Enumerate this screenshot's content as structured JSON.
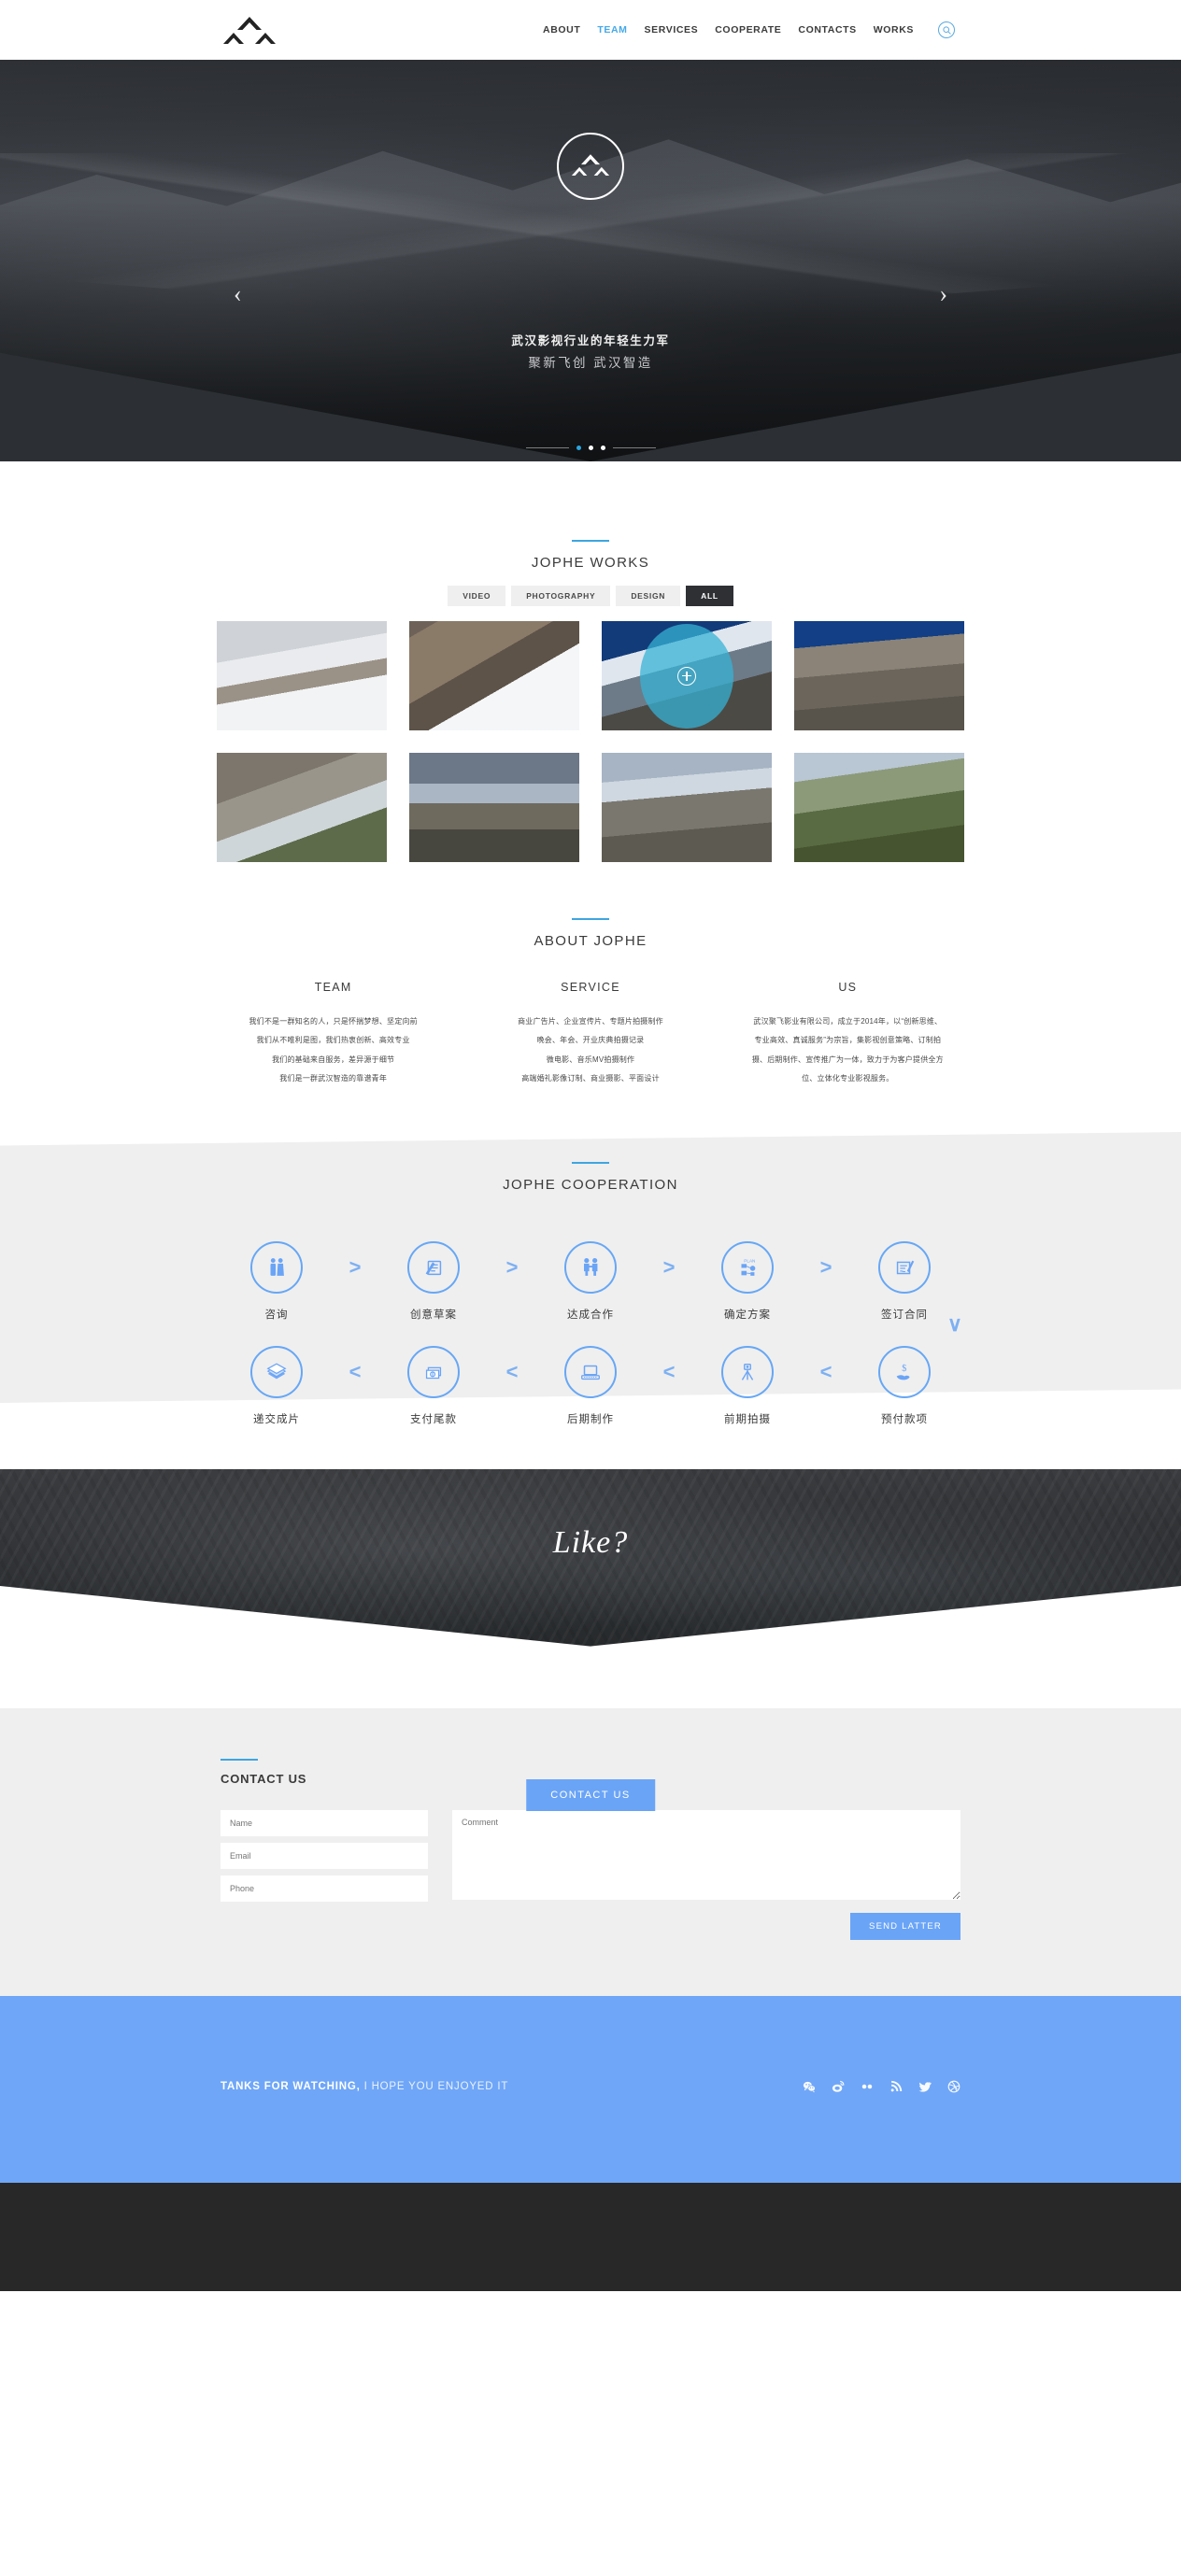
{
  "header": {
    "logo_name": "jophe-logo",
    "nav": [
      {
        "label": "ABOUT",
        "active": false
      },
      {
        "label": "TEAM",
        "active": true
      },
      {
        "label": "SERVICES",
        "active": false
      },
      {
        "label": "COOPERATE",
        "active": false
      },
      {
        "label": "CONTACTS",
        "active": false
      },
      {
        "label": "WORKS",
        "active": false
      }
    ],
    "search_icon": "search-icon"
  },
  "hero": {
    "title": "武汉影视行业的年轻生力军",
    "subtitle": "聚新飞创 武汉智造",
    "prev_arrow": "‹",
    "next_arrow": "›",
    "slides": 3,
    "active_slide": 1,
    "badge_icon": "mountain-logo-icon"
  },
  "works": {
    "title": "JOPHE WORKS",
    "filters": [
      {
        "label": "VIDEO",
        "active": false
      },
      {
        "label": "PHOTOGRAPHY",
        "active": false
      },
      {
        "label": "DESIGN",
        "active": false
      },
      {
        "label": "ALL",
        "active": true
      }
    ],
    "tiles": [
      {
        "name": "work-tile-1",
        "style": "im1",
        "hovered": false
      },
      {
        "name": "work-tile-2",
        "style": "im2",
        "hovered": false
      },
      {
        "name": "work-tile-3",
        "style": "im3",
        "hovered": true
      },
      {
        "name": "work-tile-4",
        "style": "im4",
        "hovered": false
      },
      {
        "name": "work-tile-5",
        "style": "im5",
        "hovered": false
      },
      {
        "name": "work-tile-6",
        "style": "im6",
        "hovered": false
      },
      {
        "name": "work-tile-7",
        "style": "im7",
        "hovered": false
      },
      {
        "name": "work-tile-8",
        "style": "im8",
        "hovered": false
      }
    ],
    "zoom_icon": "zoom-plus-icon"
  },
  "about": {
    "title": "ABOUT JOPHE",
    "columns": [
      {
        "heading": "TEAM",
        "lines": [
          "我们不是一群知名的人，只是怀揣梦想、坚定向前",
          "我们从不唯利是图，我们热衷创新、高效专业",
          "我们的基础来自服务，差异源于细节",
          "我们是一群武汉智造的靠谱青年"
        ]
      },
      {
        "heading": "SERVICE",
        "lines": [
          "商业广告片、企业宣传片、专题片拍摄制作",
          "晚会、年会、开业庆典拍摄记录",
          "微电影、音乐MV拍摄制作",
          "高端婚礼影像订制、商业摄影、平面设计"
        ]
      },
      {
        "heading": "US",
        "lines": [
          "武汉聚飞影业有限公司，成立于2014年，以“创新思维、",
          "专业高效、真诚服务”为宗旨，集影视创意策略、订制拍",
          "摄、后期制作、宣传推广为一体，致力于为客户提供全方",
          "位、立体化专业影视服务。"
        ]
      }
    ]
  },
  "cooperation": {
    "title": "JOPHE COOPERATION",
    "row1": [
      {
        "label": "咨询",
        "icon": "two-people-icon"
      },
      {
        "label": "创意草案",
        "icon": "draft-document-pen-icon"
      },
      {
        "label": "达成合作",
        "icon": "handshake-people-icon"
      },
      {
        "label": "确定方案",
        "icon": "plan-flowchart-icon"
      },
      {
        "label": "签订合同",
        "icon": "contract-signature-icon"
      }
    ],
    "row2": [
      {
        "label": "递交成片",
        "icon": "film-stack-icon"
      },
      {
        "label": "支付尾款",
        "icon": "money-cash-icon"
      },
      {
        "label": "后期制作",
        "icon": "laptop-editing-icon"
      },
      {
        "label": "前期拍摄",
        "icon": "tripod-camera-icon"
      },
      {
        "label": "预付款项",
        "icon": "hand-money-icon"
      }
    ],
    "separator_right": ">",
    "separator_left": "<",
    "separator_down": "∨"
  },
  "like": {
    "word": "Like?",
    "button_label": "CONTACT US"
  },
  "contact": {
    "title": "CONTACT US",
    "fields": [
      {
        "name": "name-field",
        "placeholder": "Name",
        "value": ""
      },
      {
        "name": "email-field",
        "placeholder": "Email",
        "value": ""
      },
      {
        "name": "phone-field",
        "placeholder": "Phone",
        "value": ""
      }
    ],
    "comment_placeholder": "Comment",
    "comment_value": "",
    "submit_label": "SEND LATTER"
  },
  "footer": {
    "text_strong": "TANKS FOR WATCHING,",
    "text_rest": " I HOPE YOU ENJOYED IT",
    "socials": [
      {
        "name": "wechat-icon",
        "glyph": "✆"
      },
      {
        "name": "weibo-icon",
        "glyph": "◉"
      },
      {
        "name": "flickr-icon",
        "glyph": "••"
      },
      {
        "name": "rss-icon",
        "glyph": "◝"
      },
      {
        "name": "twitter-icon",
        "glyph": "✦"
      },
      {
        "name": "dribbble-icon",
        "glyph": "◯"
      }
    ]
  },
  "colors": {
    "accent_blue": "#3ea5e0",
    "brand_blue": "#6aa4f6",
    "dark": "#282828",
    "light_gray": "#efefef"
  }
}
